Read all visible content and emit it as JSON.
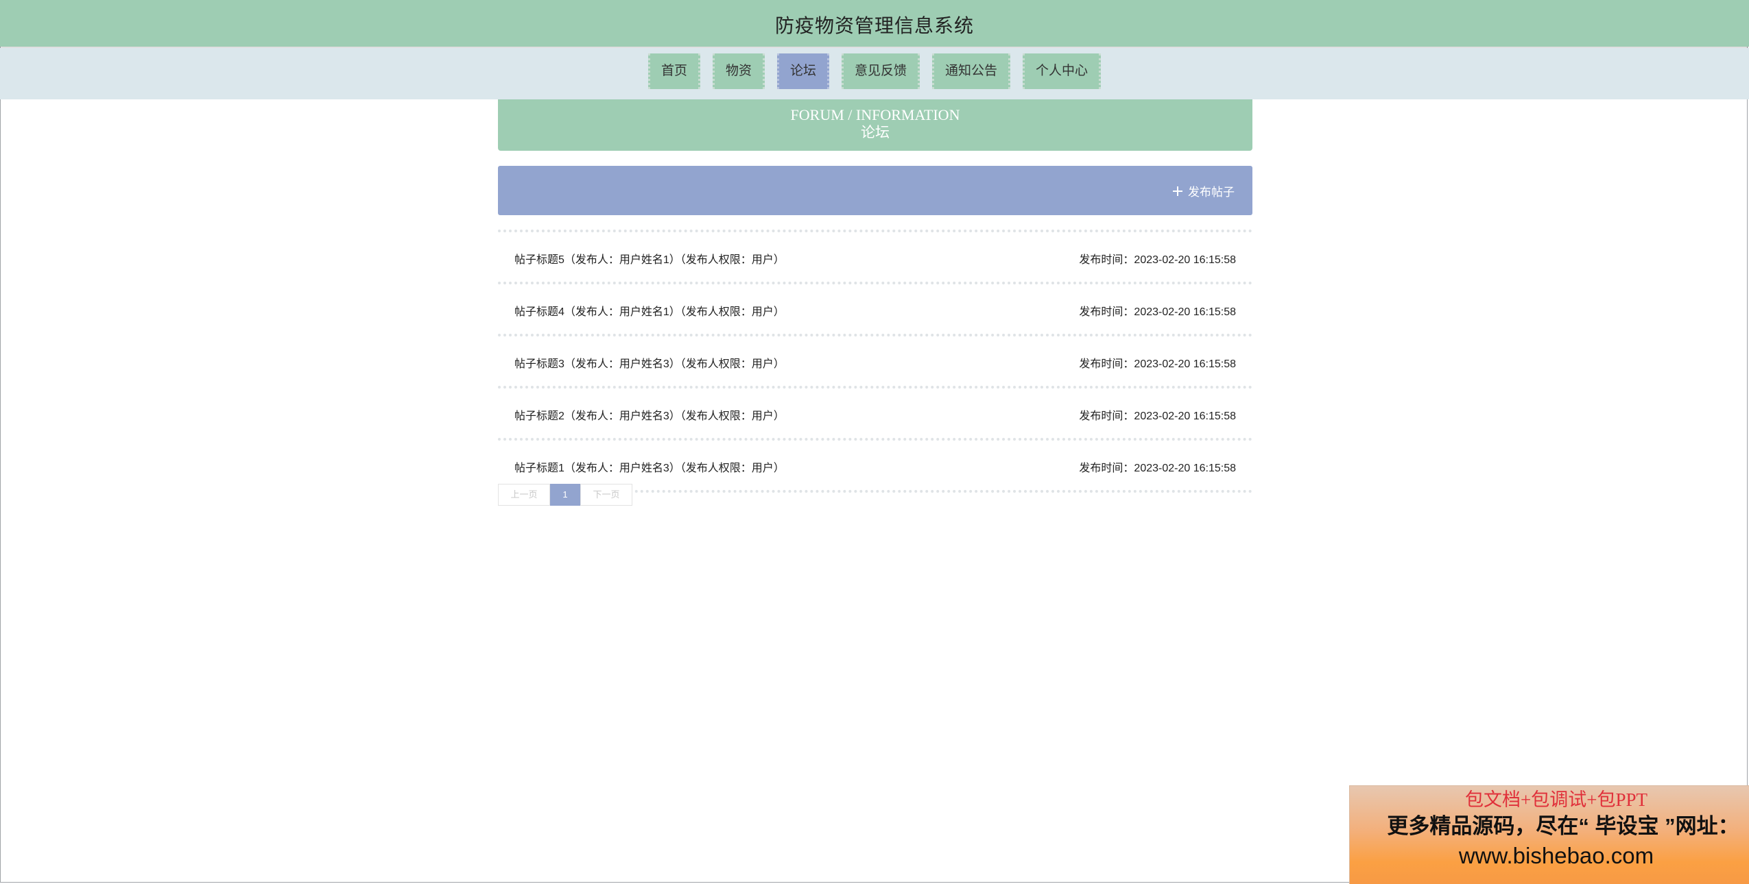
{
  "header": {
    "title": "防疫物资管理信息系统"
  },
  "nav": {
    "items": [
      {
        "label": "首页"
      },
      {
        "label": "物资"
      },
      {
        "label": "论坛"
      },
      {
        "label": "意见反馈"
      },
      {
        "label": "通知公告"
      },
      {
        "label": "个人中心"
      }
    ],
    "active_index": 2
  },
  "banner": {
    "title_en": "FORUM / INFORMATION",
    "title_cn": "论坛"
  },
  "action": {
    "publish_label": "发布帖子",
    "publish_icon": "plus-icon"
  },
  "posts": [
    {
      "title": "帖子标题5（发布人：用户姓名1）（发布人权限：用户）",
      "time": "发布时间：2023-02-20 16:15:58"
    },
    {
      "title": "帖子标题4（发布人：用户姓名1）（发布人权限：用户）",
      "time": "发布时间：2023-02-20 16:15:58"
    },
    {
      "title": "帖子标题3（发布人：用户姓名3）（发布人权限：用户）",
      "time": "发布时间：2023-02-20 16:15:58"
    },
    {
      "title": "帖子标题2（发布人：用户姓名3）（发布人权限：用户）",
      "time": "发布时间：2023-02-20 16:15:58"
    },
    {
      "title": "帖子标题1（发布人：用户姓名3）（发布人权限：用户）",
      "time": "发布时间：2023-02-20 16:15:58"
    }
  ],
  "pagination": {
    "prev_label": "上一页",
    "current_page": "1",
    "next_label": "下一页"
  },
  "ad": {
    "line1": "包文档+包调试+包PPT",
    "line2": "更多精品源码，尽在“ 毕设宝 ”网址：",
    "line3": "www.bishebao.com"
  },
  "colors": {
    "green": "#9ecdb3",
    "blue": "#92a4cf",
    "nav_bg": "#dbe7ec"
  }
}
